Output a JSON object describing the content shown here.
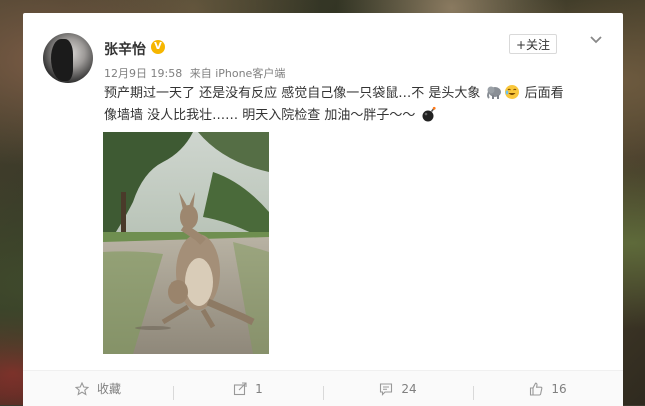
{
  "post": {
    "username": "张辛怡",
    "verified_badge": "V",
    "date": "12月9日 19:58",
    "source": "来自 iPhone客户端",
    "follow_label": "+关注",
    "text_line1": "预产期过一天了 还是没有反应 感觉自己像一只袋鼠…不 是头大象",
    "text_line1_tail": " 后面看",
    "text_line2": "像墙墙 没人比我壮…… 明天入院检查 加油～胖子～～",
    "emoji_icons": [
      "elephant-emoji-icon",
      "tear-laugh-emoji-icon",
      "bomb-emoji-icon"
    ]
  },
  "actions": {
    "favorite_label": "收藏",
    "repost_count": "1",
    "comment_count": "24",
    "like_count": "16"
  },
  "colors": {
    "accent": "#ff8140",
    "verified": "#f6b600",
    "text": "#333333",
    "meta": "#808080"
  }
}
